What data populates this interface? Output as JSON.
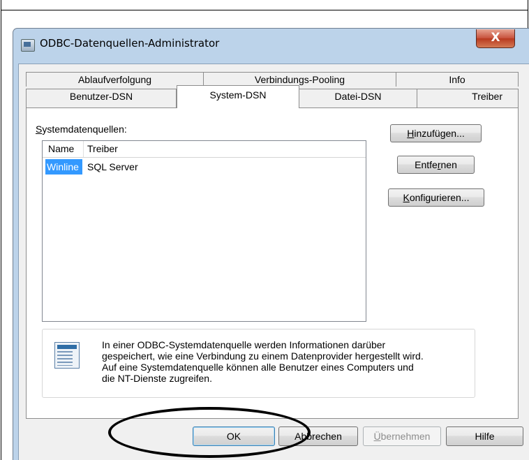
{
  "window": {
    "title": "ODBC-Datenquellen-Administrator",
    "close_glyph": "X"
  },
  "tabs_row1": [
    {
      "label": "Ablaufverfolgung"
    },
    {
      "label": "Verbindungs-Pooling"
    },
    {
      "label": "Info"
    }
  ],
  "tabs_row2": [
    {
      "label": "Benutzer-DSN"
    },
    {
      "label": "System-DSN",
      "active": true
    },
    {
      "label": "Datei-DSN"
    },
    {
      "label": "Treiber"
    }
  ],
  "panel": {
    "label_underlined": "S",
    "label_rest": "ystemdatenquellen:",
    "columns": [
      "Name",
      "Treiber"
    ],
    "rows": [
      {
        "name": "Winline",
        "driver": "SQL Server",
        "selected": true
      }
    ]
  },
  "side_buttons": {
    "add": {
      "pre": "",
      "u": "H",
      "post": "inzufügen..."
    },
    "remove": {
      "pre": "Entfe",
      "u": "r",
      "post": "nen"
    },
    "configure": {
      "pre": "",
      "u": "K",
      "post": "onfigurieren..."
    }
  },
  "info": {
    "icon": "datasource-table-icon",
    "lines": [
      "In einer ODBC-Systemdatenquelle werden Informationen darüber",
      "gespeichert, wie eine Verbindung zu einem Datenprovider hergestellt wird.",
      "Auf eine Systemdatenquelle können alle Benutzer eines Computers und",
      "die NT-Dienste zugreifen."
    ]
  },
  "bottom_buttons": {
    "ok": "OK",
    "cancel": "Abbrechen",
    "apply": {
      "pre": "",
      "u": "Ü",
      "post": "bernehmen"
    },
    "help": "Hilfe"
  },
  "colors": {
    "selection": "#3399ff",
    "window_frame": "#bcd3ea",
    "close_button": "#c7513a"
  }
}
